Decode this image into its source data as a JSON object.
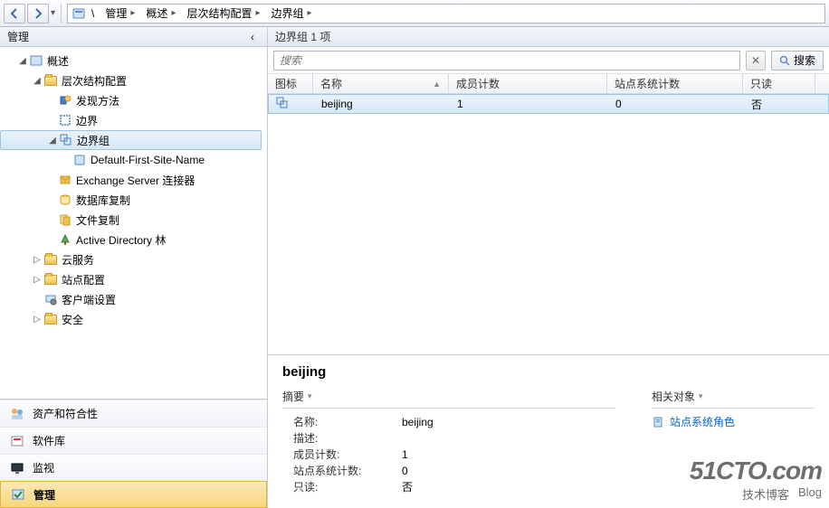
{
  "breadcrumb": {
    "items": [
      "管理",
      "概述",
      "层次结构配置",
      "边界组"
    ]
  },
  "left": {
    "header": "管理",
    "tree": {
      "overview": "概述",
      "hierarchy": "层次结构配置",
      "discovery": "发现方法",
      "boundary": "边界",
      "boundary_group": "边界组",
      "default_site": "Default-First-Site-Name",
      "exchange": "Exchange Server 连接器",
      "db_copy": "数据库复制",
      "file_copy": "文件复制",
      "ad_forest": "Active Directory 林",
      "cloud": "云服务",
      "site_config": "站点配置",
      "client_settings": "客户端设置",
      "security": "安全"
    },
    "bottom": {
      "assets": "资产和符合性",
      "software": "软件库",
      "monitor": "监视",
      "admin": "管理"
    }
  },
  "list": {
    "title": "边界组 1 项",
    "search_placeholder": "搜索",
    "search_button": "搜索",
    "columns": {
      "icon": "图标",
      "name": "名称",
      "members": "成员计数",
      "sites": "站点系统计数",
      "readonly": "只读"
    },
    "rows": [
      {
        "name": "beijing",
        "members": "1",
        "sites": "0",
        "readonly": "否"
      }
    ]
  },
  "details": {
    "title": "beijing",
    "summary_label": "摘要",
    "related_label": "相关对象",
    "site_role_link": "站点系统角色",
    "fields": {
      "name_k": "名称:",
      "name_v": "beijing",
      "desc_k": "描述:",
      "desc_v": "",
      "members_k": "成员计数:",
      "members_v": "1",
      "sites_k": "站点系统计数:",
      "sites_v": "0",
      "readonly_k": "只读:",
      "readonly_v": "否"
    }
  },
  "watermark": {
    "line1": "51CTO.com",
    "line2a": "技术博客",
    "line2b": "Blog"
  }
}
